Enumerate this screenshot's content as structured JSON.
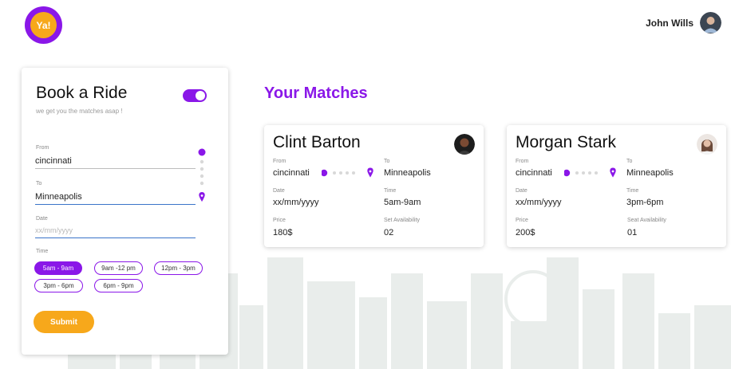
{
  "header": {
    "logo_text": "Ya!",
    "user_name": "John Wills"
  },
  "booking": {
    "title": "Book a Ride",
    "subtitle": "we get you the matches asap !",
    "from_label": "From",
    "from_value": "cincinnati",
    "to_label": "To",
    "to_value": "Minneapolis",
    "date_label": "Date",
    "date_placeholder": "xx/mm/yyyy",
    "time_label": "Time",
    "time_slots": [
      "5am - 9am",
      "9am -12 pm",
      "12pm - 3pm",
      "3pm - 6pm",
      "6pm - 9pm"
    ],
    "selected_slot": "5am - 9am",
    "submit_label": "Submit",
    "toggle_on": true
  },
  "matches": {
    "title": "Your Matches",
    "cards": [
      {
        "name": "Clint Barton",
        "from_label": "From",
        "from": "cincinnati",
        "to_label": "To",
        "to": "Minneapolis",
        "date_label": "Date",
        "date": "xx/mm/yyyy",
        "time_label": "Time",
        "time": "5am-9am",
        "price_label": "Price",
        "price": "180$",
        "seats_label": "Set Availability",
        "seats": "02"
      },
      {
        "name": "Morgan Stark",
        "from_label": "From",
        "from": "cincinnati",
        "to_label": "To",
        "to": "Minneapolis",
        "date_label": "Date",
        "date": "xx/mm/yyyy",
        "time_label": "Time",
        "time": "3pm-6pm",
        "price_label": "Price",
        "price": "200$",
        "seats_label": "Seat Availability",
        "seats": "01"
      }
    ]
  },
  "colors": {
    "accent": "#8a17e8",
    "button": "#f7a81b",
    "skyline": "#e8ecea"
  },
  "icons": {
    "user_avatar": "avatar-icon",
    "route_end": "location-pin-icon",
    "toggle": "toggle-switch"
  }
}
